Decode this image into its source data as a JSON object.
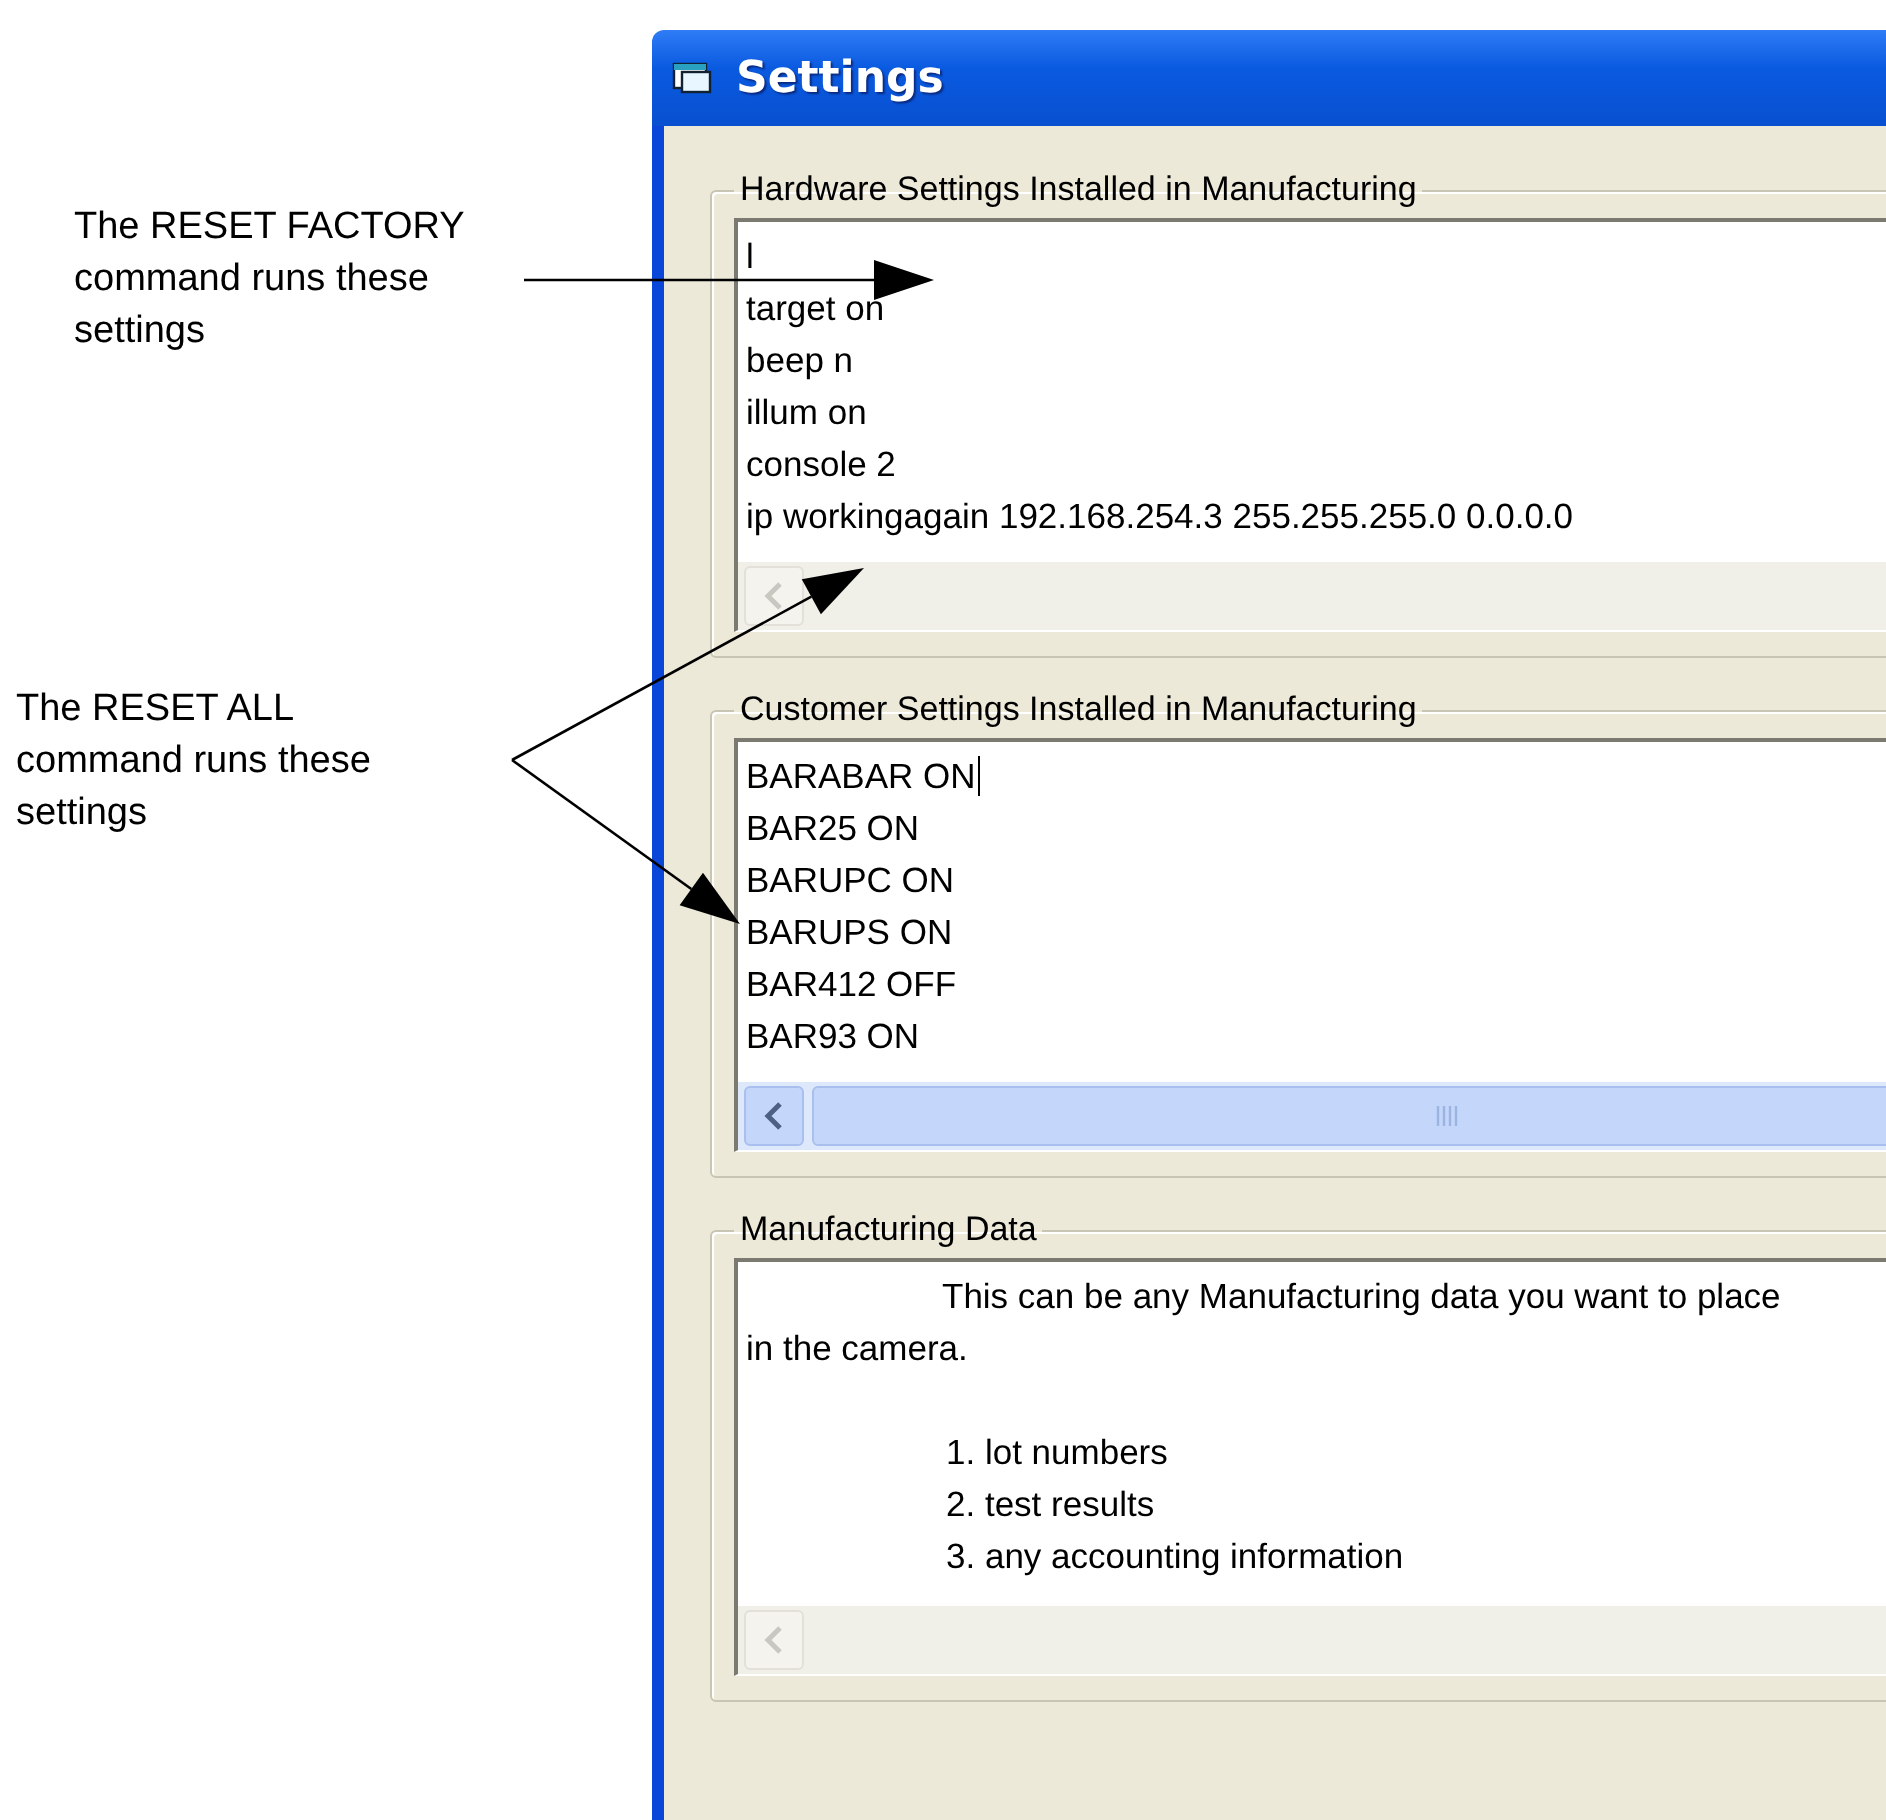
{
  "annotations": [
    {
      "text": "The RESET FACTORY command runs these settings"
    },
    {
      "text": "The RESET ALL command runs these settings"
    }
  ],
  "window": {
    "title": "Settings"
  },
  "groups": [
    {
      "kind": "lines",
      "title": "Hardware Settings Installed in Manufacturing",
      "lines": [
        "l",
        "target on",
        "beep n",
        "illum on",
        "console 2",
        "ip workingagain 192.168.254.3 255.255.255.0 0.0.0.0"
      ],
      "focused": false,
      "scrollbar_enabled": false
    },
    {
      "kind": "lines",
      "title": "Customer Settings Installed in Manufacturing",
      "lines": [
        "BARABAR ON",
        "BAR25 ON",
        "BARUPC ON",
        "BARUPS ON",
        "BAR412 OFF",
        "BAR93 ON"
      ],
      "focused": true,
      "scrollbar_enabled": true
    },
    {
      "kind": "note",
      "title": "Manufacturing Data",
      "paragraph": "This can be any Manufacturing data you want to place in the camera.",
      "list_items": [
        "1. lot numbers",
        "2. test results",
        "3. any accounting information"
      ],
      "focused": false,
      "scrollbar_enabled": false
    }
  ]
}
